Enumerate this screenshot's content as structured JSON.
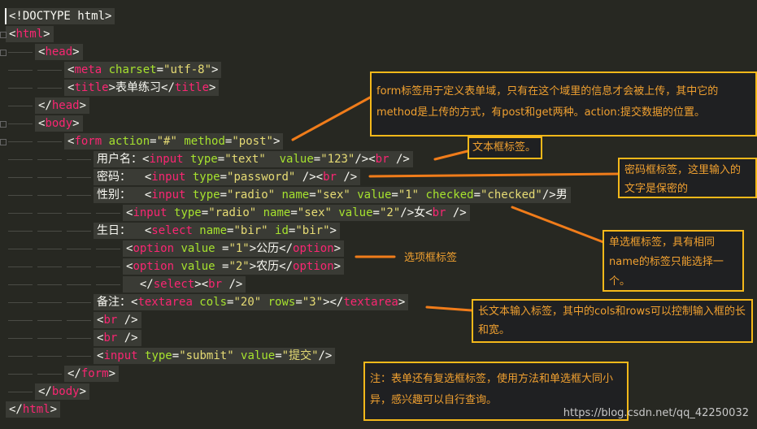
{
  "code_lines": [
    {
      "indent": 0,
      "parts": [
        {
          "t": "<!DOCTYPE html>",
          "c": "punc"
        }
      ]
    },
    {
      "indent": 0,
      "parts": [
        {
          "t": "<",
          "c": "punc"
        },
        {
          "t": "html",
          "c": "tag"
        },
        {
          "t": ">",
          "c": "punc"
        }
      ]
    },
    {
      "indent": 1,
      "parts": [
        {
          "t": "<",
          "c": "punc"
        },
        {
          "t": "head",
          "c": "tag"
        },
        {
          "t": ">",
          "c": "punc"
        }
      ]
    },
    {
      "indent": 2,
      "parts": [
        {
          "t": "<",
          "c": "punc"
        },
        {
          "t": "meta",
          "c": "tag"
        },
        {
          "t": " charset",
          "c": "attr"
        },
        {
          "t": "=",
          "c": "punc"
        },
        {
          "t": "\"utf-8\"",
          "c": "str"
        },
        {
          "t": ">",
          "c": "punc"
        }
      ]
    },
    {
      "indent": 2,
      "parts": [
        {
          "t": "<",
          "c": "punc"
        },
        {
          "t": "title",
          "c": "tag"
        },
        {
          "t": ">表单练习</",
          "c": "punc"
        },
        {
          "t": "title",
          "c": "tag"
        },
        {
          "t": ">",
          "c": "punc"
        }
      ]
    },
    {
      "indent": 1,
      "parts": [
        {
          "t": "</",
          "c": "punc"
        },
        {
          "t": "head",
          "c": "tag"
        },
        {
          "t": ">",
          "c": "punc"
        }
      ]
    },
    {
      "indent": 1,
      "parts": [
        {
          "t": "<",
          "c": "punc"
        },
        {
          "t": "body",
          "c": "tag"
        },
        {
          "t": ">",
          "c": "punc"
        }
      ]
    },
    {
      "indent": 2,
      "parts": [
        {
          "t": "<",
          "c": "punc"
        },
        {
          "t": "form",
          "c": "tag"
        },
        {
          "t": " action",
          "c": "attr"
        },
        {
          "t": "=",
          "c": "punc"
        },
        {
          "t": "\"#\"",
          "c": "str"
        },
        {
          "t": " method",
          "c": "attr"
        },
        {
          "t": "=",
          "c": "punc"
        },
        {
          "t": "\"post\"",
          "c": "str"
        },
        {
          "t": ">",
          "c": "punc"
        }
      ]
    },
    {
      "indent": 3,
      "parts": [
        {
          "t": "用户名：",
          "c": "txt"
        },
        {
          "t": "<",
          "c": "punc"
        },
        {
          "t": "input",
          "c": "tag"
        },
        {
          "t": " type",
          "c": "attr"
        },
        {
          "t": "=",
          "c": "punc"
        },
        {
          "t": "\"text\"",
          "c": "str"
        },
        {
          "t": "  value",
          "c": "attr"
        },
        {
          "t": "=",
          "c": "punc"
        },
        {
          "t": "\"123\"",
          "c": "str"
        },
        {
          "t": "/><",
          "c": "punc"
        },
        {
          "t": "br",
          "c": "tag"
        },
        {
          "t": " />",
          "c": "punc"
        }
      ]
    },
    {
      "indent": 3,
      "parts": [
        {
          "t": "密码：  ",
          "c": "txt"
        },
        {
          "t": "<",
          "c": "punc"
        },
        {
          "t": "input",
          "c": "tag"
        },
        {
          "t": " type",
          "c": "attr"
        },
        {
          "t": "=",
          "c": "punc"
        },
        {
          "t": "\"password\"",
          "c": "str"
        },
        {
          "t": " /><",
          "c": "punc"
        },
        {
          "t": "br",
          "c": "tag"
        },
        {
          "t": " />",
          "c": "punc"
        }
      ]
    },
    {
      "indent": 3,
      "parts": [
        {
          "t": "性别：  ",
          "c": "txt"
        },
        {
          "t": "<",
          "c": "punc"
        },
        {
          "t": "input",
          "c": "tag"
        },
        {
          "t": " type",
          "c": "attr"
        },
        {
          "t": "=",
          "c": "punc"
        },
        {
          "t": "\"radio\"",
          "c": "str"
        },
        {
          "t": " name",
          "c": "attr"
        },
        {
          "t": "=",
          "c": "punc"
        },
        {
          "t": "\"sex\"",
          "c": "str"
        },
        {
          "t": " value",
          "c": "attr"
        },
        {
          "t": "=",
          "c": "punc"
        },
        {
          "t": "\"1\"",
          "c": "str"
        },
        {
          "t": " checked",
          "c": "attr"
        },
        {
          "t": "=",
          "c": "punc"
        },
        {
          "t": "\"checked\"",
          "c": "str"
        },
        {
          "t": "/>男",
          "c": "punc"
        }
      ]
    },
    {
      "indent": 4,
      "parts": [
        {
          "t": "<",
          "c": "punc"
        },
        {
          "t": "input",
          "c": "tag"
        },
        {
          "t": " type",
          "c": "attr"
        },
        {
          "t": "=",
          "c": "punc"
        },
        {
          "t": "\"radio\"",
          "c": "str"
        },
        {
          "t": " name",
          "c": "attr"
        },
        {
          "t": "=",
          "c": "punc"
        },
        {
          "t": "\"sex\"",
          "c": "str"
        },
        {
          "t": " value",
          "c": "attr"
        },
        {
          "t": "=",
          "c": "punc"
        },
        {
          "t": "\"2\"",
          "c": "str"
        },
        {
          "t": "/>女<",
          "c": "punc"
        },
        {
          "t": "br",
          "c": "tag"
        },
        {
          "t": " />",
          "c": "punc"
        }
      ]
    },
    {
      "indent": 3,
      "parts": [
        {
          "t": "生日：  ",
          "c": "txt"
        },
        {
          "t": "<",
          "c": "punc"
        },
        {
          "t": "select",
          "c": "tag"
        },
        {
          "t": " name",
          "c": "attr"
        },
        {
          "t": "=",
          "c": "punc"
        },
        {
          "t": "\"bir\"",
          "c": "str"
        },
        {
          "t": " id",
          "c": "attr"
        },
        {
          "t": "=",
          "c": "punc"
        },
        {
          "t": "\"bir\"",
          "c": "str"
        },
        {
          "t": ">",
          "c": "punc"
        }
      ]
    },
    {
      "indent": 4,
      "parts": [
        {
          "t": "<",
          "c": "punc"
        },
        {
          "t": "option",
          "c": "tag"
        },
        {
          "t": " value",
          "c": "attr"
        },
        {
          "t": " =",
          "c": "punc"
        },
        {
          "t": "\"1\"",
          "c": "str"
        },
        {
          "t": ">公历</",
          "c": "punc"
        },
        {
          "t": "option",
          "c": "tag"
        },
        {
          "t": ">",
          "c": "punc"
        }
      ]
    },
    {
      "indent": 4,
      "parts": [
        {
          "t": "<",
          "c": "punc"
        },
        {
          "t": "option",
          "c": "tag"
        },
        {
          "t": " value",
          "c": "attr"
        },
        {
          "t": " =",
          "c": "punc"
        },
        {
          "t": "\"2\"",
          "c": "str"
        },
        {
          "t": ">农历</",
          "c": "punc"
        },
        {
          "t": "option",
          "c": "tag"
        },
        {
          "t": ">",
          "c": "punc"
        }
      ]
    },
    {
      "indent": 4,
      "parts": [
        {
          "t": "  </",
          "c": "punc"
        },
        {
          "t": "select",
          "c": "tag"
        },
        {
          "t": "><",
          "c": "punc"
        },
        {
          "t": "br",
          "c": "tag"
        },
        {
          "t": " />",
          "c": "punc"
        }
      ]
    },
    {
      "indent": 3,
      "parts": [
        {
          "t": "备注：",
          "c": "txt"
        },
        {
          "t": "<",
          "c": "punc"
        },
        {
          "t": "textarea",
          "c": "tag"
        },
        {
          "t": " cols",
          "c": "attr"
        },
        {
          "t": "=",
          "c": "punc"
        },
        {
          "t": "\"20\"",
          "c": "str"
        },
        {
          "t": " rows",
          "c": "attr"
        },
        {
          "t": "=",
          "c": "punc"
        },
        {
          "t": "\"3\"",
          "c": "str"
        },
        {
          "t": "></",
          "c": "punc"
        },
        {
          "t": "textarea",
          "c": "tag"
        },
        {
          "t": ">",
          "c": "punc"
        }
      ]
    },
    {
      "indent": 3,
      "parts": [
        {
          "t": "<",
          "c": "punc"
        },
        {
          "t": "br",
          "c": "tag"
        },
        {
          "t": " />",
          "c": "punc"
        }
      ]
    },
    {
      "indent": 3,
      "parts": [
        {
          "t": "<",
          "c": "punc"
        },
        {
          "t": "br",
          "c": "tag"
        },
        {
          "t": " />",
          "c": "punc"
        }
      ]
    },
    {
      "indent": 3,
      "parts": [
        {
          "t": "<",
          "c": "punc"
        },
        {
          "t": "input",
          "c": "tag"
        },
        {
          "t": " type",
          "c": "attr"
        },
        {
          "t": "=",
          "c": "punc"
        },
        {
          "t": "\"submit\"",
          "c": "str"
        },
        {
          "t": " value",
          "c": "attr"
        },
        {
          "t": "=",
          "c": "punc"
        },
        {
          "t": "\"提交\"",
          "c": "str"
        },
        {
          "t": "/>",
          "c": "punc"
        }
      ]
    },
    {
      "indent": 2,
      "parts": [
        {
          "t": "</",
          "c": "punc"
        },
        {
          "t": "form",
          "c": "tag"
        },
        {
          "t": ">",
          "c": "punc"
        }
      ]
    },
    {
      "indent": 1,
      "parts": [
        {
          "t": "</",
          "c": "punc"
        },
        {
          "t": "body",
          "c": "tag"
        },
        {
          "t": ">",
          "c": "punc"
        }
      ]
    },
    {
      "indent": 0,
      "parts": [
        {
          "t": "</",
          "c": "punc"
        },
        {
          "t": "html",
          "c": "tag"
        },
        {
          "t": ">",
          "c": "punc"
        }
      ]
    }
  ],
  "notes": {
    "form": "form标签用于定义表单域，只有在这个域里的信息才会被上传，其中它的method是上传的方式，有post和get两种。action:提交数据的位置。",
    "text": "文本框标签。",
    "password": "密码框标签，这里输入的文字是保密的",
    "radio": "单选框标签，具有相同name的标签只能选择一个。",
    "select": "选项框标签",
    "textarea": "长文本输入标签，其中的cols和rows可以控制输入框的长和宽。",
    "extra": "注：表单还有复选框标签，使用方法和单选框大同小异，感兴趣可以自行查询。"
  },
  "watermark": "https://blog.csdn.net/qq_42250032",
  "colors": {
    "tag": "#f92672",
    "attr": "#a6e22e",
    "str": "#e6db74",
    "note_border": "#f4b81a",
    "note_text": "#f0a030",
    "arrow": "#f07c1a"
  }
}
